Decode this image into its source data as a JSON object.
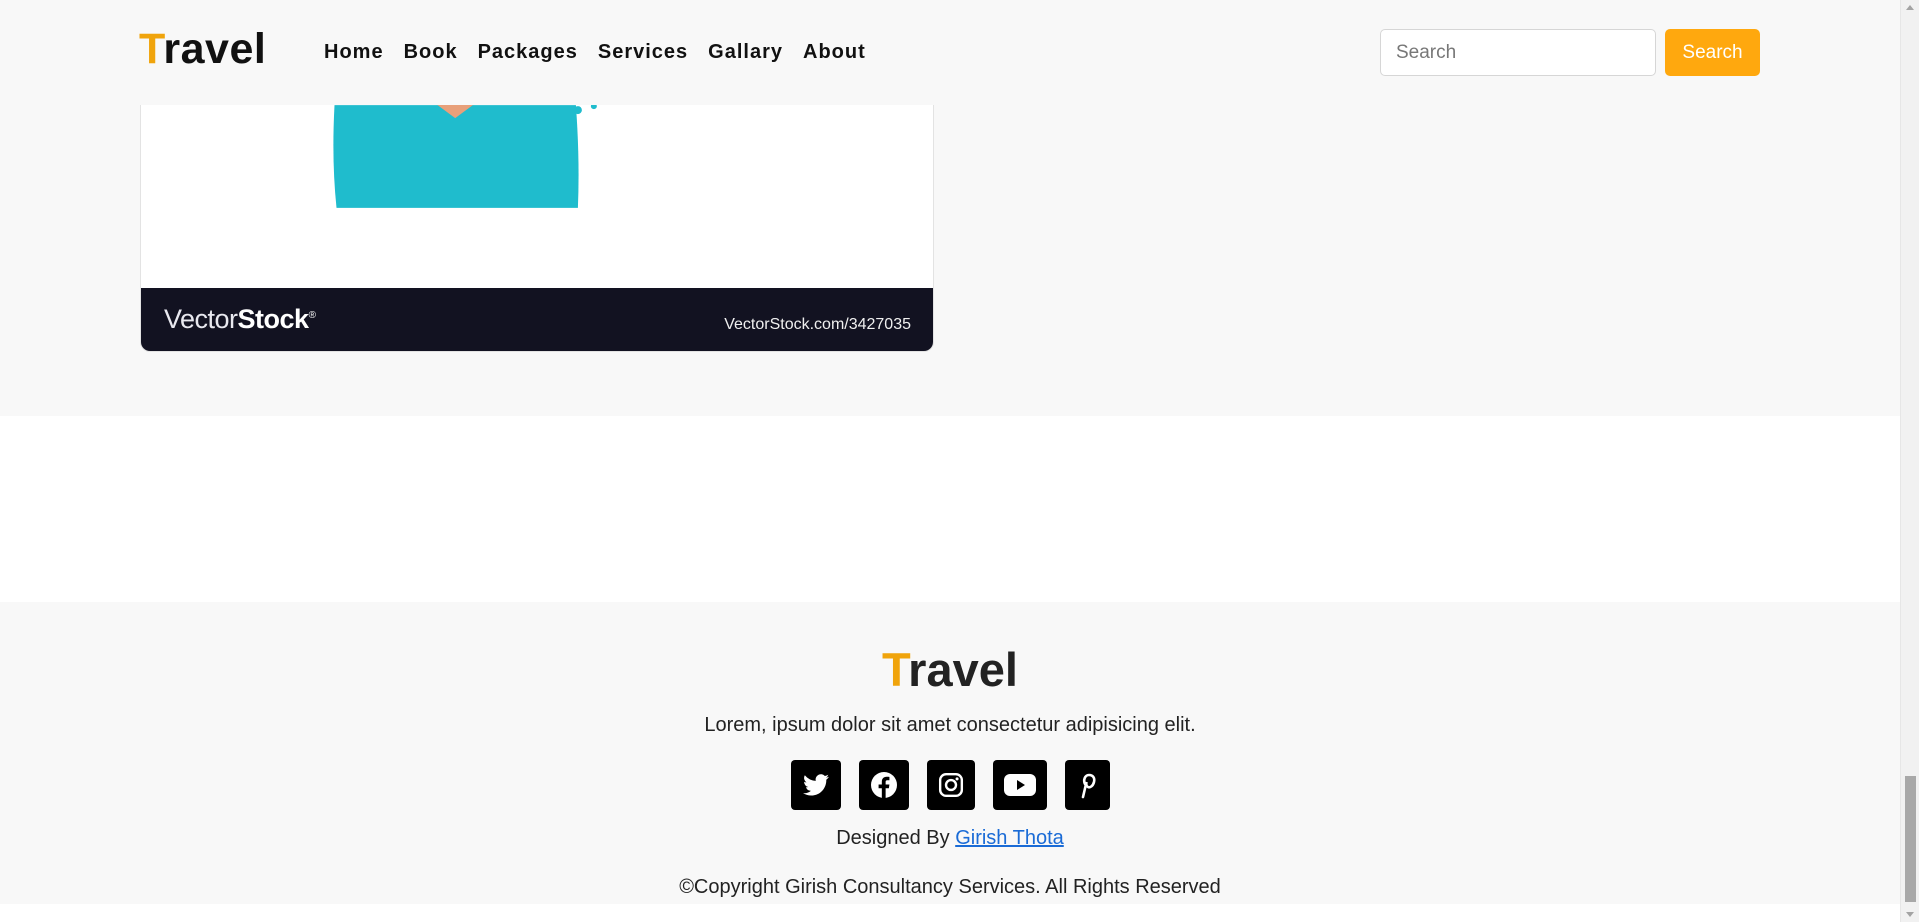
{
  "navbar": {
    "brand_first": "T",
    "brand_rest": "ravel",
    "links": [
      "Home",
      "Book",
      "Packages",
      "Services",
      "Gallary",
      "About"
    ],
    "search_placeholder": "Search",
    "search_button": "Search"
  },
  "image_card": {
    "vs_logo_thin": "Vector",
    "vs_logo_bold": "Stock",
    "vs_logo_mark": "®",
    "vs_id": "VectorStock.com/3427035"
  },
  "footer": {
    "brand_first": "T",
    "brand_rest": "ravel",
    "description": "Lorem, ipsum dolor sit amet consectetur adipisicing elit.",
    "socials": [
      "twitter-icon",
      "facebook-icon",
      "instagram-icon",
      "youtube-icon",
      "pinterest-icon"
    ],
    "designed_prefix": "Designed By ",
    "designer": "Girish Thota",
    "copyright": "©Copyright Girish Consultancy Services. All Rights Reserved"
  },
  "colors": {
    "accent": "#ffa80e",
    "brand_t": "#f0a40c",
    "link": "#1a6bd6",
    "vs_bar": "#121221",
    "figure_teal": "#1fbccd"
  }
}
